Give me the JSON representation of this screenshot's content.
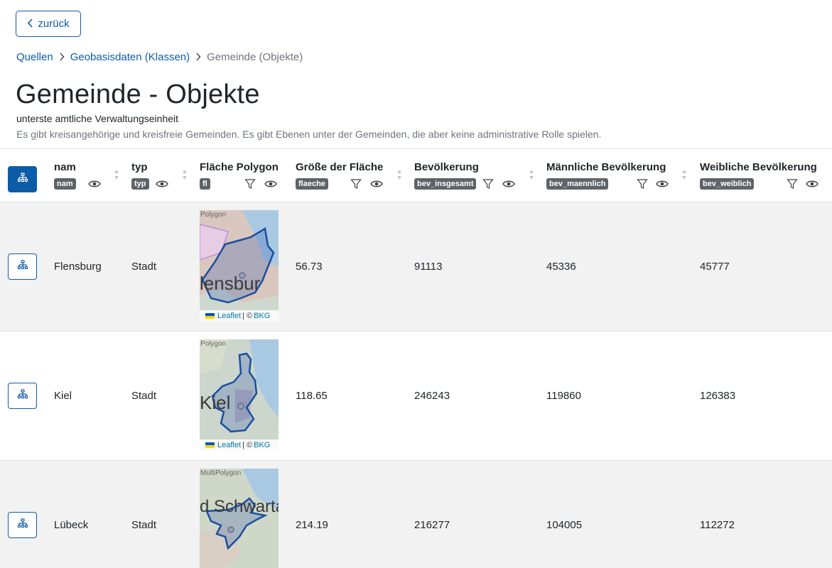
{
  "nav": {
    "back_label": "zurück"
  },
  "breadcrumb": {
    "items": [
      "Quellen",
      "Geobasisdaten (Klassen)"
    ],
    "current": "Gemeinde (Objekte)"
  },
  "page": {
    "title": "Gemeinde - Objekte",
    "subtitle": "unterste amtliche Verwaltungseinheit",
    "description": "Es gibt kreisangehörige und kreisfreie Gemeinden. Es gibt Ebenen unter der Gemeinden, die aber keine administrative Rolle spielen."
  },
  "table": {
    "columns": [
      {
        "title": "nam",
        "key": "nam"
      },
      {
        "title": "typ",
        "key": "typ"
      },
      {
        "title": "Fläche Polygon",
        "key": "fl"
      },
      {
        "title": "Größe der Fläche",
        "key": "flaeche"
      },
      {
        "title": "Bevölkerung",
        "key": "bev_insgesamt"
      },
      {
        "title": "Männliche Bevölkerung",
        "key": "bev_maennlich"
      },
      {
        "title": "Weibliche Bevölkerung",
        "key": "bev_weiblich"
      }
    ],
    "rows": [
      {
        "nam": "Flensburg",
        "typ": "Stadt",
        "geom_type": "Polygon",
        "flaeche": "56.73",
        "bev_insgesamt": "91113",
        "bev_maennlich": "45336",
        "bev_weiblich": "45777",
        "map_text": "lensbur"
      },
      {
        "nam": "Kiel",
        "typ": "Stadt",
        "geom_type": "Polygon",
        "flaeche": "118.65",
        "bev_insgesamt": "246243",
        "bev_maennlich": "119860",
        "bev_weiblich": "126383",
        "map_text": "Kiel"
      },
      {
        "nam": "Lübeck",
        "typ": "Stadt",
        "geom_type": "MultiPolygon",
        "flaeche": "214.19",
        "bev_insgesamt": "216277",
        "bev_maennlich": "104005",
        "bev_weiblich": "112272",
        "map_text": "d Schwartau"
      }
    ],
    "map_attribution": {
      "leaflet": "Leaflet",
      "sep": " | © ",
      "source": "BKG"
    }
  },
  "colors": {
    "primary": "#0d5ca8",
    "badge": "#5f6368",
    "row_alt": "#f2f2f2",
    "polygon": "#1a4fa0"
  }
}
